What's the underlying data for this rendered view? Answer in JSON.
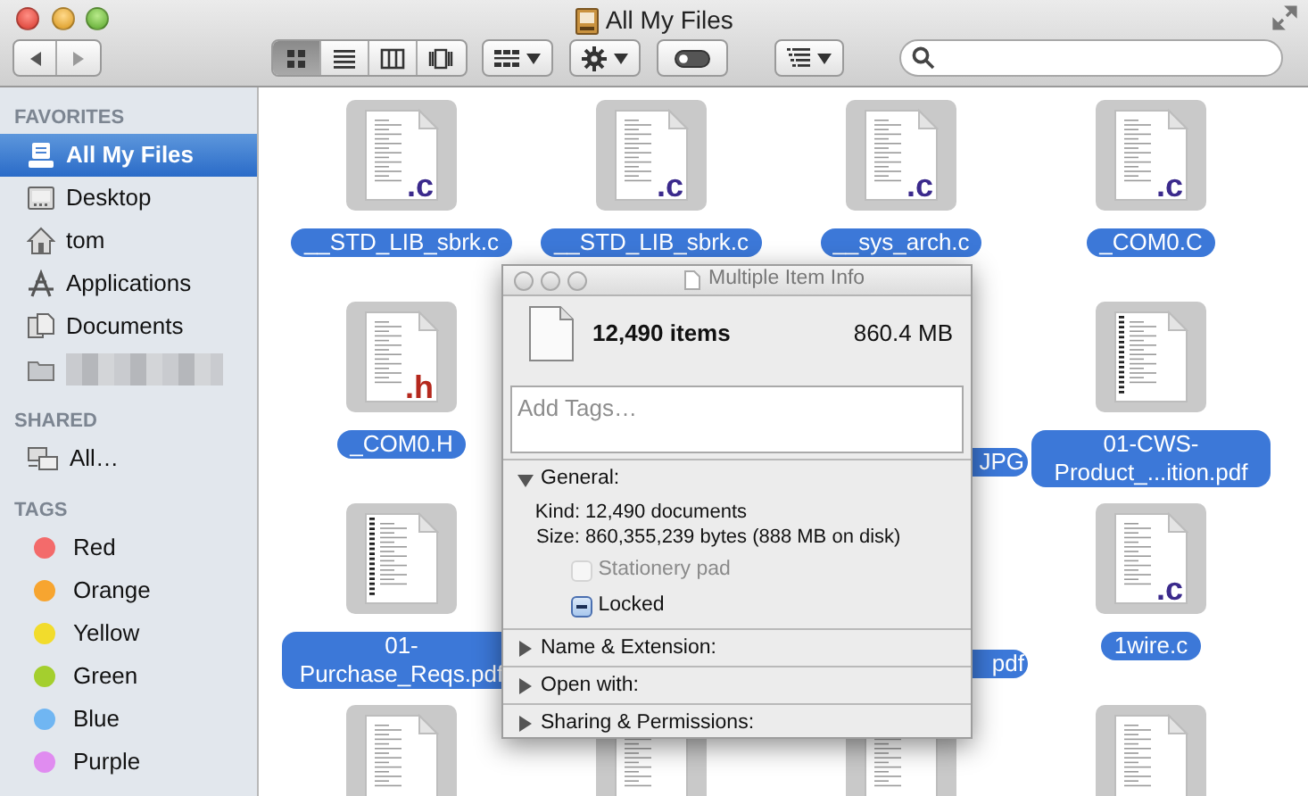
{
  "window": {
    "title": "All My Files"
  },
  "toolbar": {
    "view_buttons": [
      {
        "kind": "icon",
        "selected": true
      },
      {
        "kind": "list",
        "selected": false
      },
      {
        "kind": "column",
        "selected": false
      },
      {
        "kind": "coverflow",
        "selected": false
      }
    ]
  },
  "sidebar": [
    {
      "title": "FAVORITES",
      "items": [
        {
          "kind": "all-files",
          "label": "All My Files",
          "selected": true
        },
        {
          "kind": "desktop",
          "label": "Desktop",
          "selected": false
        },
        {
          "kind": "home",
          "label": "tom",
          "selected": false
        },
        {
          "kind": "apps",
          "label": "Applications",
          "selected": false
        },
        {
          "kind": "documents",
          "label": "Documents",
          "selected": false
        },
        {
          "kind": "folder-redacted",
          "selected": false
        }
      ]
    },
    {
      "title": "SHARED",
      "items": [
        {
          "kind": "network",
          "label": "All…",
          "selected": false
        }
      ]
    },
    {
      "title": "TAGS",
      "items": [
        {
          "kind": "tag",
          "label": "Red",
          "color": "#f36b6b",
          "selected": false
        },
        {
          "kind": "tag",
          "label": "Orange",
          "color": "#f7a530",
          "selected": false
        },
        {
          "kind": "tag",
          "label": "Yellow",
          "color": "#f2dc2c",
          "selected": false
        },
        {
          "kind": "tag",
          "label": "Green",
          "color": "#a4cf2e",
          "selected": false
        },
        {
          "kind": "tag",
          "label": "Blue",
          "color": "#70b6f2",
          "selected": false
        },
        {
          "kind": "tag",
          "label": "Purple",
          "color": "#e08cf0",
          "selected": false
        }
      ]
    }
  ],
  "files": [
    {
      "kind": "source",
      "label": "__STD_LIB_sbrk.c",
      "ext": ".c",
      "selected": true
    },
    {
      "kind": "source",
      "label": "__STD_LIB_sbrk.c",
      "ext": ".c",
      "selected": true
    },
    {
      "kind": "source",
      "label": "__sys_arch.c",
      "ext": ".c",
      "selected": true
    },
    {
      "kind": "source",
      "label": "_COM0.C",
      "ext": ".c",
      "selected": true
    },
    {
      "kind": "header",
      "label": "_COM0.H",
      "ext": ".h",
      "selected": true
    },
    {
      "kind": "covered"
    },
    {
      "kind": "covered",
      "label": "JPG",
      "selected": true
    },
    {
      "kind": "pdf",
      "label": "01-CWS-Product_...ition.pdf",
      "selected": true
    },
    {
      "kind": "pdf",
      "label": "01-Purchase_Reqs.pdf",
      "selected": true
    },
    {
      "kind": "covered"
    },
    {
      "kind": "covered",
      "label": "pdf",
      "selected": true
    },
    {
      "kind": "source",
      "label": "1wire.c",
      "ext": ".c",
      "selected": true
    },
    {
      "kind": "cut"
    },
    {
      "kind": "cut"
    },
    {
      "kind": "cut"
    },
    {
      "kind": "cut"
    }
  ],
  "info": {
    "title": "Multiple Item Info",
    "count": "12,490 items",
    "size": "860.4 MB",
    "tags_placeholder": "Add Tags…",
    "sections": [
      {
        "label": "General:",
        "expanded": true,
        "rows": [
          {
            "key": "Kind:",
            "value": "12,490 documents"
          },
          {
            "key": "Size:",
            "value": "860,355,239 bytes (888 MB on disk)"
          }
        ],
        "checks": [
          {
            "label": "Stationery pad",
            "checked": false,
            "mixed": false,
            "disabled": true
          },
          {
            "label": "Locked",
            "mixed": true,
            "disabled": false
          }
        ]
      },
      {
        "label": "Name & Extension:",
        "expanded": false
      },
      {
        "label": "Open with:",
        "expanded": false
      },
      {
        "label": "Sharing & Permissions:",
        "expanded": false
      }
    ]
  }
}
